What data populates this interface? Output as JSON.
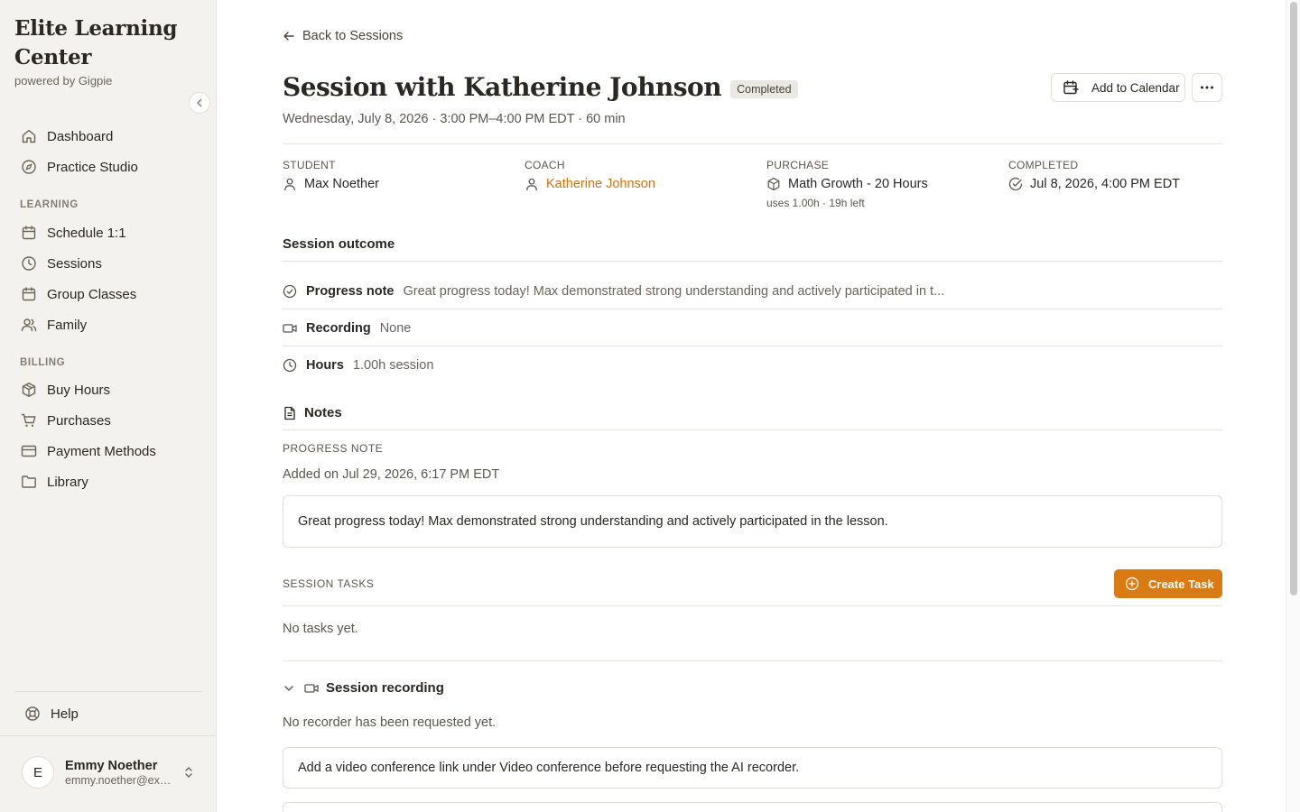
{
  "brand": {
    "title": "Elite Learning Center",
    "subtitle": "powered by Gigpie"
  },
  "sidebar": {
    "top_items": [
      {
        "label": "Dashboard",
        "icon": "home-icon"
      },
      {
        "label": "Practice Studio",
        "icon": "compass-icon"
      }
    ],
    "learning_heading": "LEARNING",
    "learning_items": [
      {
        "label": "Schedule 1:1",
        "icon": "calendar-icon"
      },
      {
        "label": "Sessions",
        "icon": "clock-icon"
      },
      {
        "label": "Group Classes",
        "icon": "calendar-icon"
      },
      {
        "label": "Family",
        "icon": "users-icon"
      }
    ],
    "billing_heading": "BILLING",
    "billing_items": [
      {
        "label": "Buy Hours",
        "icon": "package-icon"
      },
      {
        "label": "Purchases",
        "icon": "cart-icon"
      },
      {
        "label": "Payment Methods",
        "icon": "credit-card-icon"
      },
      {
        "label": "Library",
        "icon": "folder-icon"
      }
    ],
    "help_label": "Help",
    "user": {
      "initial": "E",
      "name": "Emmy Noether",
      "email": "emmy.noether@example.com"
    }
  },
  "header": {
    "back_label": "Back to Sessions",
    "title": "Session with Katherine Johnson",
    "status_badge": "Completed",
    "subtitle": "Wednesday, July 8, 2026 · 3:00 PM–4:00 PM EDT · 60 min",
    "add_calendar_label": "Add to Calendar"
  },
  "meta": {
    "student_label": "STUDENT",
    "student_value": "Max Noether",
    "coach_label": "COACH",
    "coach_value": "Katherine Johnson",
    "purchase_label": "PURCHASE",
    "purchase_value": "Math Growth - 20 Hours",
    "purchase_sub": "uses 1.00h · 19h left",
    "completed_label": "COMPLETED",
    "completed_value": "Jul 8, 2026, 4:00 PM EDT"
  },
  "outcome": {
    "title": "Session outcome",
    "progress_label": "Progress note",
    "progress_value": "Great progress today! Max demonstrated strong understanding and actively participated in t...",
    "recording_label": "Recording",
    "recording_value": "None",
    "hours_label": "Hours",
    "hours_value": "1.00h session"
  },
  "notes": {
    "title": "Notes",
    "progress_heading": "PROGRESS NOTE",
    "added": "Added on Jul 29, 2026, 6:17 PM EDT",
    "note_text": "Great progress today! Max demonstrated strong understanding and actively participated in the lesson."
  },
  "tasks": {
    "heading": "SESSION TASKS",
    "create_label": "Create Task",
    "empty": "No tasks yet."
  },
  "recording": {
    "title": "Session recording",
    "empty": "No recorder has been requested yet.",
    "hint": "Add a video conference link under Video conference before requesting the AI recorder."
  },
  "colors": {
    "accent": "#d97a12",
    "link": "#d07210",
    "sidebar_bg": "#f4f2ee"
  }
}
